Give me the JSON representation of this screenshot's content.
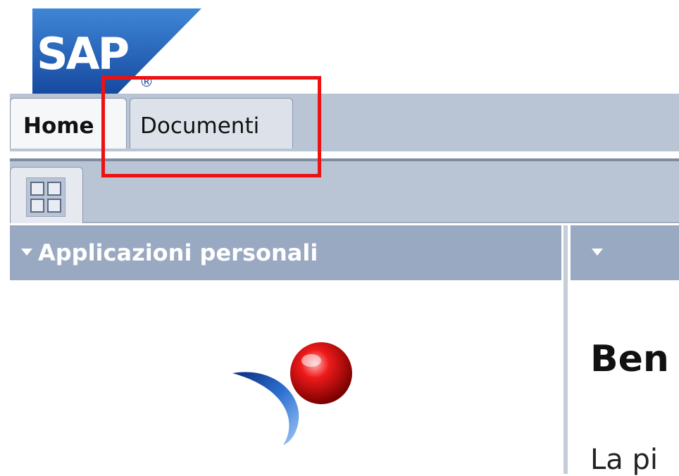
{
  "brand": {
    "logo_text": "SAP",
    "registered_mark": "®",
    "colors": {
      "logo_blue": "#1f5ab0",
      "tabbar": "#b9c4d4",
      "panel_header": "#9aa9c2",
      "highlight": "#ee1111"
    }
  },
  "tabs": [
    {
      "label": "Home",
      "active": true
    },
    {
      "label": "Documenti",
      "active": false
    }
  ],
  "subtabs": [
    {
      "icon": "grid-icon"
    }
  ],
  "panels": {
    "left": {
      "title": "Applicazioni personali",
      "icon": "triangle-down-icon"
    },
    "right": {
      "title": "",
      "icon": "triangle-down-icon"
    }
  },
  "content": {
    "welcome": "Ben",
    "body": "La pi"
  }
}
